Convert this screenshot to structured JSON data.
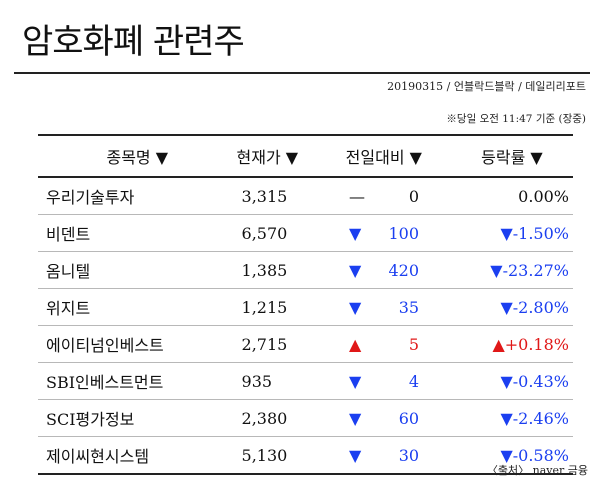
{
  "title": "암호화폐 관련주",
  "byline": "20190315 / 언블락드블락 / 데일리리포트",
  "timenote": "※당일 오전 11:47 기준 (장중)",
  "headers": {
    "name": "종목명 ▼",
    "price": "현재가 ▼",
    "change": "전일대비 ▼",
    "rate": "등락률 ▼"
  },
  "rows": [
    {
      "name": "우리기술투자",
      "price": "3,315",
      "dir": "flat",
      "sym": "—",
      "change": "0",
      "rate": "0.00%"
    },
    {
      "name": "비덴트",
      "price": "6,570",
      "dir": "down",
      "sym": "▼",
      "change": "100",
      "rate": "▼-1.50%"
    },
    {
      "name": "옴니텔",
      "price": "1,385",
      "dir": "down",
      "sym": "▼",
      "change": "420",
      "rate": "▼-23.27%"
    },
    {
      "name": "위지트",
      "price": "1,215",
      "dir": "down",
      "sym": "▼",
      "change": "35",
      "rate": "▼-2.80%"
    },
    {
      "name": "에이티넘인베스트",
      "price": "2,715",
      "dir": "up",
      "sym": "▲",
      "change": "5",
      "rate": "▲+0.18%"
    },
    {
      "name": "SBI인베스트먼트",
      "price": "935",
      "dir": "down",
      "sym": "▼",
      "change": "4",
      "rate": "▼-0.43%"
    },
    {
      "name": "SCI평가정보",
      "price": "2,380",
      "dir": "down",
      "sym": "▼",
      "change": "60",
      "rate": "▼-2.46%"
    },
    {
      "name": "제이씨현시스템",
      "price": "5,130",
      "dir": "down",
      "sym": "▼",
      "change": "30",
      "rate": "▼-0.58%"
    }
  ],
  "source": "〈출처〉 naver 금융",
  "colors": {
    "down": "#1b3ff0",
    "up": "#e01818",
    "flat": "#111111"
  }
}
